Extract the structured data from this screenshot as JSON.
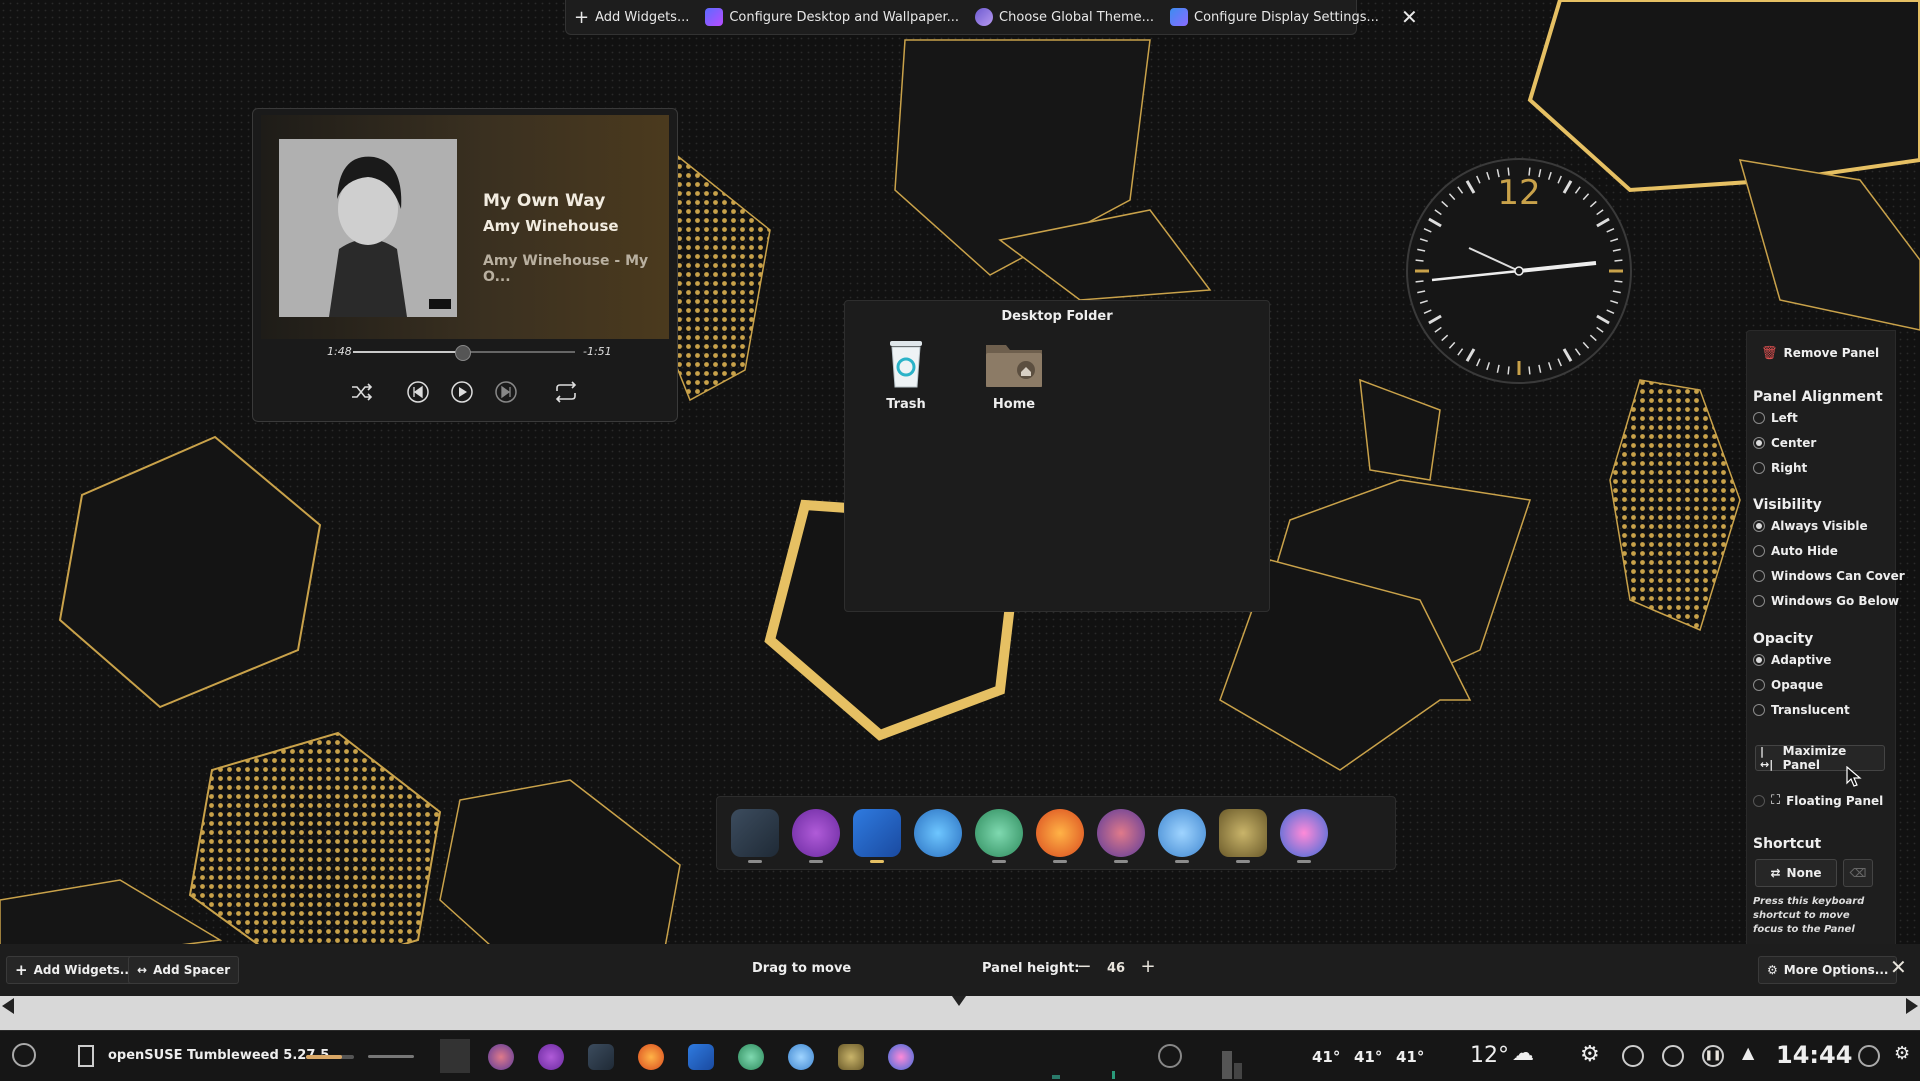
{
  "top_toolbar": {
    "add_widgets": "Add Widgets...",
    "configure_desktop": "Configure Desktop and Wallpaper...",
    "choose_theme": "Choose Global Theme...",
    "configure_display": "Configure Display Settings..."
  },
  "player": {
    "title": "My Own Way",
    "artist": "Amy Winehouse",
    "album": "Amy Winehouse - My O...",
    "elapsed": "1:48",
    "remaining": "-1:51",
    "progress": 0.49
  },
  "desktop_folder": {
    "title": "Desktop Folder",
    "items": [
      {
        "label": "Trash"
      },
      {
        "label": "Home"
      }
    ]
  },
  "clock": {
    "hour_marker": "12"
  },
  "panel_settings": {
    "remove_panel": "Remove Panel",
    "alignment": {
      "heading": "Panel Alignment",
      "options": [
        "Left",
        "Center",
        "Right"
      ],
      "selected": "Center"
    },
    "visibility": {
      "heading": "Visibility",
      "options": [
        "Always Visible",
        "Auto Hide",
        "Windows Can Cover",
        "Windows Go Below"
      ],
      "selected": "Always Visible"
    },
    "opacity": {
      "heading": "Opacity",
      "options": [
        "Adaptive",
        "Opaque",
        "Translucent"
      ],
      "selected": "Adaptive"
    },
    "maximize_panel": "Maximize Panel",
    "floating_panel": "Floating Panel",
    "shortcut": {
      "heading": "Shortcut",
      "value": "None",
      "help": "Press this keyboard shortcut to move focus to the Panel"
    }
  },
  "edit_bar": {
    "add_widgets": "Add Widgets...",
    "add_spacer": "Add Spacer",
    "drag_to_move": "Drag to move",
    "panel_height_label": "Panel height:",
    "panel_height_value": "46",
    "more_options": "More Options..."
  },
  "taskbar": {
    "os_label": "openSUSE Tumbleweed 5.27.5",
    "temps": [
      "41°",
      "41°",
      "41°"
    ],
    "weather_temp": "12°",
    "time": "14:44"
  },
  "colors": {
    "gold": "#c9a24a",
    "panel_bg": "#1e1e1e",
    "wallpaper_bg": "#121212"
  }
}
